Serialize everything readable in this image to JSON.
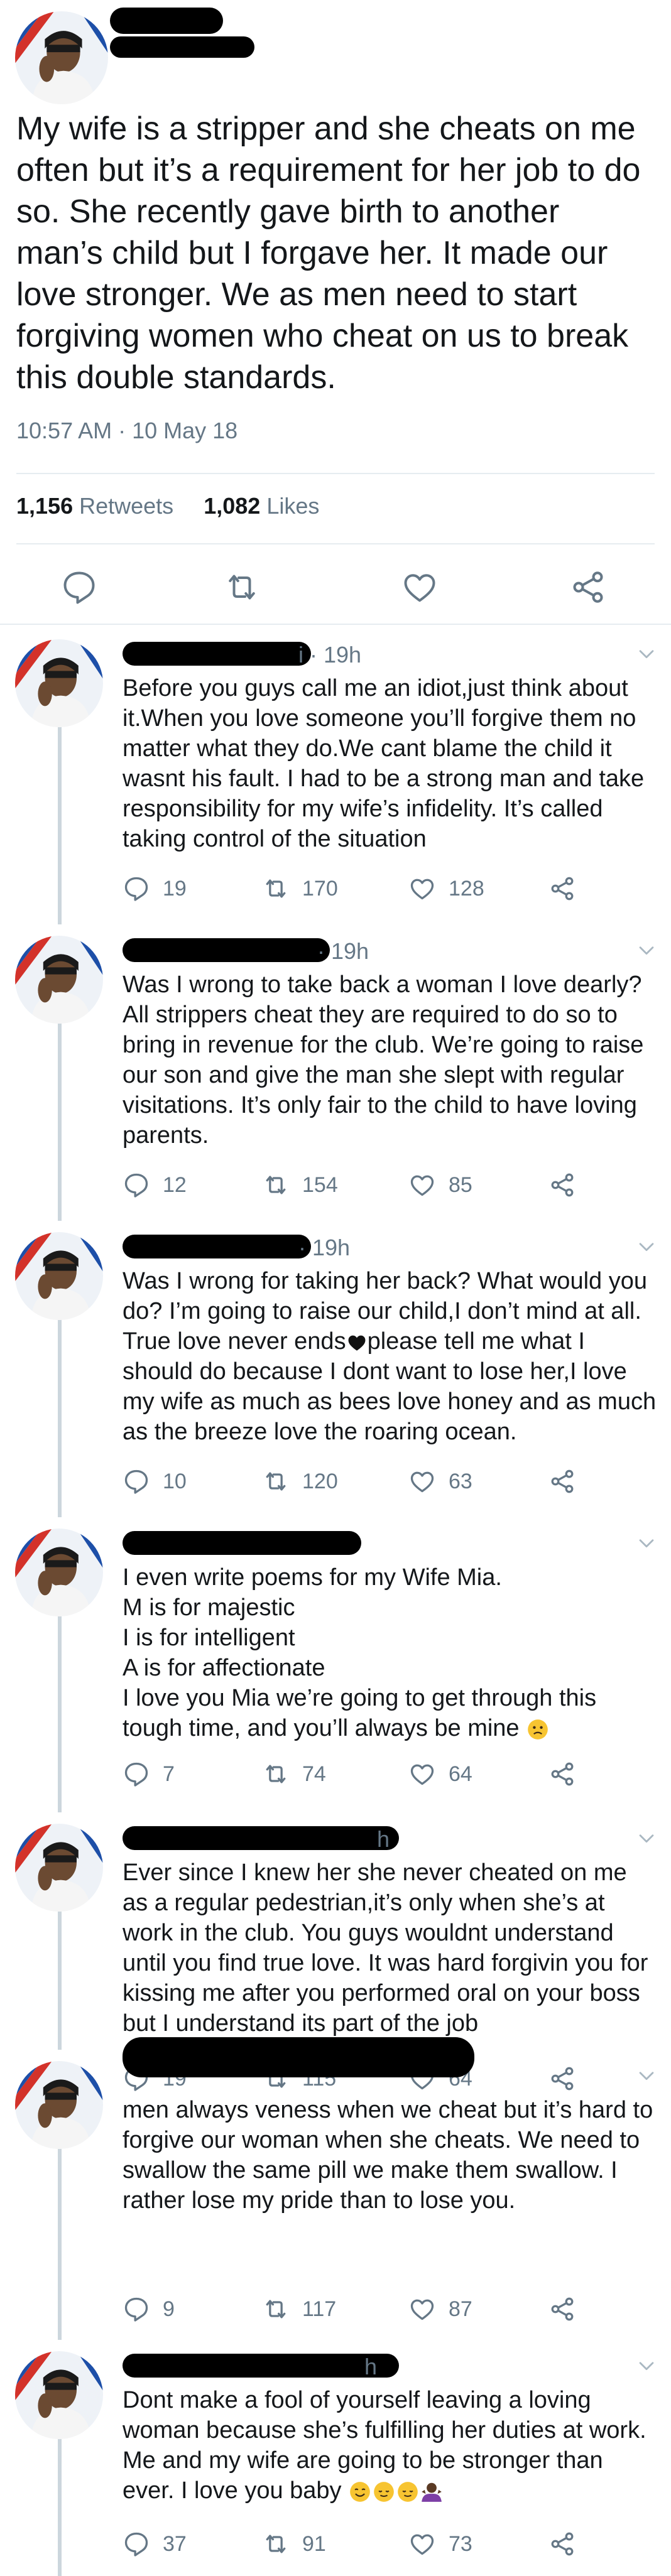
{
  "main_tweet": {
    "text": "My wife is a stripper and she cheats on me often but it’s a requirement for her job to do so. She recently gave birth to another man’s child but I forgave her. It made our love stronger. We as men need to start forgiving women who cheat on us to break this double standards.",
    "timestamp": "10:57 AM · 10 May 18",
    "retweets_count": "1,156",
    "retweets_label": "Retweets",
    "likes_count": "1,082",
    "likes_label": "Likes",
    "icons": [
      "reply-icon",
      "retweet-icon",
      "like-icon",
      "share-icon"
    ]
  },
  "replies": [
    {
      "time": "i · 19h",
      "text": "Before you guys call me an idiot,just think about it.When you love someone you’ll forgive them no matter what they do.We cant blame the child it wasnt his fault. I had to be a strong man and take responsibility for my wife’s infidelity. It’s called taking control of the situation",
      "replies": "19",
      "retweets": "170",
      "likes": "128"
    },
    {
      "time": "· 19h",
      "text": "Was I wrong to take back a woman I love dearly? All strippers cheat they are required to do so to bring in revenue for the club. We’re going to raise our son and give the man she slept with regular visitations. It’s only fair to the child to have loving parents.",
      "replies": "12",
      "retweets": "154",
      "likes": "85"
    },
    {
      "time": "· 19h",
      "text_before_heart": "Was I wrong for taking her back? What would you do? I’m going to raise our child,I don’t mind at all. True love never ends",
      "text_after_heart": "please tell me what I should do because I dont want to lose her,I love my wife as much as bees love honey and as much as the breeze love the roaring ocean.",
      "replies": "10",
      "retweets": "120",
      "likes": "63"
    },
    {
      "time": "",
      "lines": [
        "I even write poems for my Wife Mia.",
        "M is for majestic",
        "I is for intelligent",
        "A is for affectionate",
        "I love you Mia we’re going to get through this tough time, and you’ll always be mine"
      ],
      "replies": "7",
      "retweets": "74",
      "likes": "64"
    },
    {
      "time": "h",
      "text": "Ever since I knew her she never cheated on me as a regular pedestrian,it’s only when she’s at work in the club. You guys wouldnt understand until you find true love. It was hard forgivin you for kissing me after you performed oral on your boss but I understand its part of the job",
      "replies": "19",
      "retweets": "115",
      "likes": "64"
    },
    {
      "time": "",
      "text": "men always veness when we cheat but it’s hard to forgive our woman when she cheats. We need to swallow the same pill we make them swallow. I rather lose my pride than to lose you.",
      "replies": "9",
      "retweets": "117",
      "likes": "87"
    },
    {
      "time": "h",
      "text": "Dont make a fool of yourself leaving a loving woman because she’s fulfilling her duties at work. Me and my wife are going to be stronger than ever. I love you baby",
      "replies": "37",
      "retweets": "91",
      "likes": "73"
    }
  ],
  "colors": {
    "text": "#14171a",
    "secondary": "#657786",
    "icon": "#657786",
    "divider": "#e6ecf0",
    "thread_line": "#ccd6dd",
    "avatar_blue": "#1d4fa8",
    "avatar_red": "#d3322a"
  }
}
